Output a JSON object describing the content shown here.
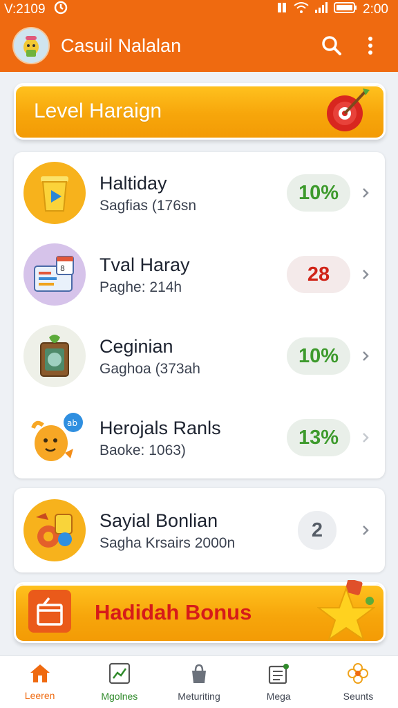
{
  "status_bar": {
    "time_left": "V:2109",
    "clock": "2:00"
  },
  "app_bar": {
    "title": "Casuil Nalalan",
    "icons": [
      "search-icon",
      "more-vert-icon"
    ]
  },
  "level_banner": {
    "label": "Level Haraign",
    "icon": "target-dart-icon"
  },
  "list": [
    {
      "title": "Haltiday",
      "subtitle": "Sagfias (176sn",
      "badge": "10%",
      "badge_color": "#3d9a2c",
      "icon": "trash-play-icon"
    },
    {
      "title": "Tval Haray",
      "subtitle": "Paghe: 214h",
      "badge": "28",
      "badge_color": "#d02418",
      "icon": "calendar-board-icon"
    },
    {
      "title": "Ceginian",
      "subtitle": "Gaghoa (373ah",
      "badge": "10%",
      "badge_color": "#3d9a2c",
      "icon": "clipboard-plant-icon"
    },
    {
      "title": "Herojals Ranls",
      "subtitle": "Baoke: 1063)",
      "badge": "13%",
      "badge_color": "#3d9a2c",
      "icon": "mascot-chat-icon"
    }
  ],
  "single_item": {
    "title": "Sayial Bonlian",
    "subtitle": "Sagha Krsairs 2000n",
    "badge": "2",
    "icon": "gear-toys-icon"
  },
  "bonus_banner": {
    "label": "Hadidah Bonus",
    "icons": [
      "gift-box-icon",
      "star-icon"
    ]
  },
  "bottom_nav": [
    {
      "label": "Leeren",
      "icon": "home-icon"
    },
    {
      "label": "Mgolnes",
      "icon": "chart-icon"
    },
    {
      "label": "Meturiting",
      "icon": "bag-icon"
    },
    {
      "label": "Mega",
      "icon": "news-icon"
    },
    {
      "label": "Seunts",
      "icon": "flower-icon"
    }
  ],
  "colors": {
    "primary": "#ef6a10",
    "banner_gold": "#f7a60b",
    "bonus_red": "#d61a1a",
    "green": "#3d9a2c"
  }
}
